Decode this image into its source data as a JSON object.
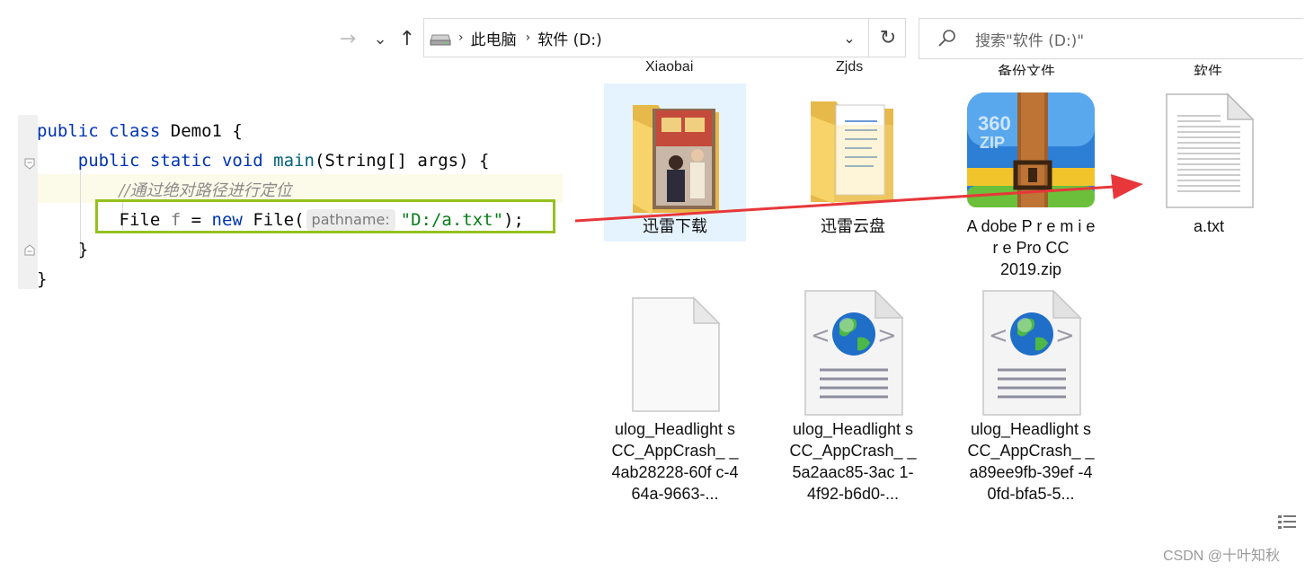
{
  "explorer": {
    "nav": {
      "forward_icon": "→",
      "recent_icon": "⌄",
      "up_icon": "↑"
    },
    "breadcrumb": [
      "此电脑",
      "软件 (D:)"
    ],
    "breadcrumb_separator": "›",
    "dropdown_icon": "⌄",
    "refresh_icon": "↻",
    "search_placeholder": "搜索\"软件 (D:)\"",
    "partial_top_labels": [
      "Xiaobai",
      "Zjds",
      "备份文件",
      "软件"
    ],
    "items": [
      {
        "name": "迅雷下载",
        "icon": "folder-photo-icon",
        "selected": true
      },
      {
        "name": "迅雷云盘",
        "icon": "folder-documents-icon",
        "selected": false
      },
      {
        "name": "A dobe P r e m i e r e Pro CC 2019.zip",
        "icon": "zip-archive-360-icon",
        "selected": false
      },
      {
        "name": "a.txt",
        "icon": "text-file-icon",
        "selected": false
      },
      {
        "name": "ulog_Headlight sCC_AppCrash_ _4ab28228-60f c-464a-9663-...",
        "icon": "blank-file-icon",
        "selected": false
      },
      {
        "name": "ulog_Headlight sCC_AppCrash_ _5a2aac85-3ac 1-4f92-b6d0-...",
        "icon": "html-globe-file-icon",
        "selected": false
      },
      {
        "name": "ulog_Headlight sCC_AppCrash_ _a89ee9fb-39ef -40fd-bfa5-5...",
        "icon": "html-globe-file-icon",
        "selected": false
      }
    ]
  },
  "code": {
    "line1": {
      "kw1": "public",
      "kw2": "class",
      "name": "Demo1",
      "brace": "{"
    },
    "line2": {
      "kw1": "public",
      "kw2": "static",
      "kw3": "void",
      "method": "main",
      "params": "(String[] args) {"
    },
    "line3": {
      "comment": "//通过绝对路径进行定位"
    },
    "line4": {
      "type": "File",
      "var": "f",
      "eq": "=",
      "kw": "new",
      "call": "File(",
      "hint": "pathname:",
      "str": "\"D:/a.txt\"",
      "end": ");"
    },
    "line5": {
      "brace": "}"
    },
    "line6": {
      "brace": "}"
    }
  },
  "colors": {
    "keyword": "#0033b3",
    "string": "#067d17",
    "comment": "#8c8c8c",
    "highlight_box": "#95c11f",
    "arrow": "#e8373a",
    "selection": "#e5f3ff"
  },
  "watermark": "CSDN @十叶知秋"
}
